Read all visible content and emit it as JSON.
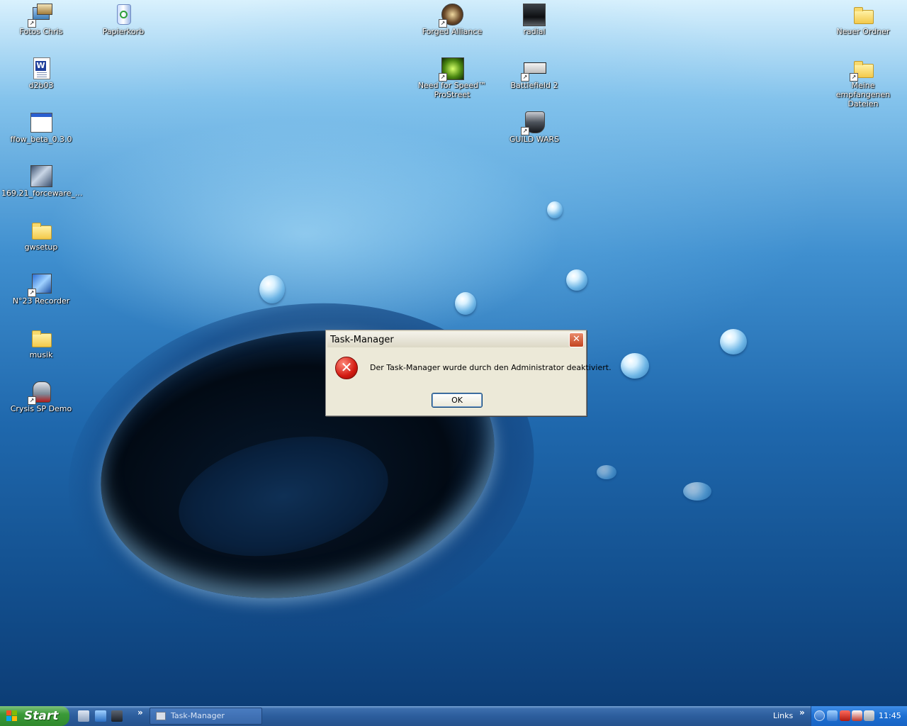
{
  "desktop": {
    "icons": [
      {
        "label": "Fotos Chris"
      },
      {
        "label": "Papierkorb"
      },
      {
        "label": "d2b03"
      },
      {
        "label": "ffow_beta_0.3.0"
      },
      {
        "label": "169.21_forceware_..."
      },
      {
        "label": "gwsetup"
      },
      {
        "label": "N°23 Recorder"
      },
      {
        "label": "musik"
      },
      {
        "label": "Crysis SP Demo"
      },
      {
        "label": "Forged Alliance"
      },
      {
        "label": "radial"
      },
      {
        "label": "Need for Speed™ ProStreet"
      },
      {
        "label": "Battlefield 2"
      },
      {
        "label": "GUILD WARS"
      },
      {
        "label": "Neuer Ordner"
      },
      {
        "label": "Meine empfangenen Dateien"
      }
    ]
  },
  "dialog": {
    "title": "Task-Manager",
    "close_glyph": "✕",
    "icon": "error-icon",
    "icon_glyph": "✕",
    "message": "Der Task-Manager wurde durch den Administrator deaktiviert.",
    "ok_label": "OK"
  },
  "taskbar": {
    "start_label": "Start",
    "quick_launch_chevron": "»",
    "task_button_label": "Task-Manager",
    "links_label": "Links",
    "links_chevron": "»",
    "clock": "11:45"
  },
  "colors": {
    "start_green": "#3b9a38",
    "taskbar_blue": "#2c5d9d",
    "tray_blue": "#1d6fd2",
    "error_red": "#d31b12",
    "dialog_face": "#ece9d8"
  }
}
